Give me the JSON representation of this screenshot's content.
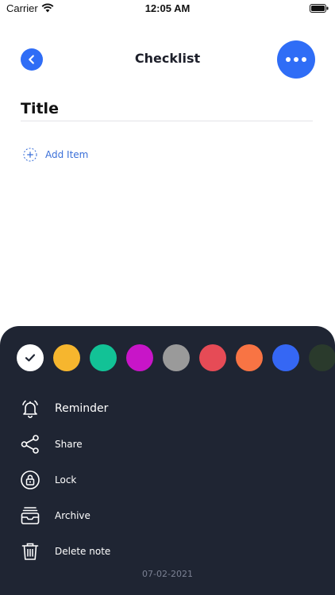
{
  "status_bar": {
    "carrier": "Carrier",
    "time": "12:05 AM"
  },
  "header": {
    "title": "Checklist"
  },
  "note": {
    "title_placeholder": "Title",
    "add_item_label": "Add Item"
  },
  "colors": {
    "accent": "#2f6df6",
    "sheet_bg": "#1f2533",
    "swatches": [
      {
        "name": "white",
        "hex": "#ffffff",
        "selected": true
      },
      {
        "name": "yellow",
        "hex": "#f6b62e",
        "selected": false
      },
      {
        "name": "teal",
        "hex": "#12c296",
        "selected": false
      },
      {
        "name": "magenta",
        "hex": "#c815c8",
        "selected": false
      },
      {
        "name": "gray",
        "hex": "#9a9a9a",
        "selected": false
      },
      {
        "name": "red",
        "hex": "#e64b56",
        "selected": false
      },
      {
        "name": "orange",
        "hex": "#f87444",
        "selected": false
      },
      {
        "name": "blue",
        "hex": "#3567f4",
        "selected": false
      },
      {
        "name": "dark-green",
        "hex": "#2a3a2c",
        "selected": false
      }
    ]
  },
  "menu": {
    "reminder": "Reminder",
    "share": "Share",
    "lock": "Lock",
    "archive": "Archive",
    "delete": "Delete note"
  },
  "footer": {
    "date": "07-02-2021"
  }
}
